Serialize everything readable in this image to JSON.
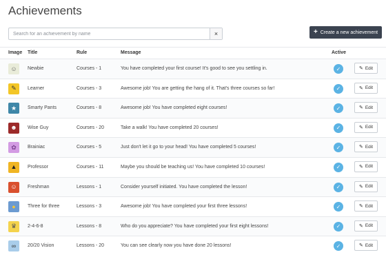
{
  "header": {
    "title": "Achievements"
  },
  "search": {
    "placeholder": "Search for an achievement by name",
    "clear": "×"
  },
  "create_button": {
    "icon": "+",
    "label": "Create a new achievement"
  },
  "columns": {
    "image": "Image",
    "title": "Title",
    "rule": "Rule",
    "message": "Message",
    "active": "Active"
  },
  "edit_label": "Edit",
  "rows": [
    {
      "title": "Newbie",
      "rule": "Courses - 1",
      "message": "You have completed your first course! It's good to see you settling in.",
      "icon": "face-icon",
      "bg": "#e9ecd9",
      "glyph": "☺",
      "color": "#666",
      "active": true
    },
    {
      "title": "Learner",
      "rule": "Courses - 3",
      "message": "Awesome job! You are getting the hang of it. That's three courses so far!",
      "icon": "pencil-badge-icon",
      "bg": "#f3c627",
      "glyph": "✎",
      "color": "#333",
      "active": true
    },
    {
      "title": "Smarty Pants",
      "rule": "Courses - 8",
      "message": "Awesome job! You have completed eight courses!",
      "icon": "smarty-pants-icon",
      "bg": "#3f87a8",
      "glyph": "★",
      "color": "#fff",
      "active": true
    },
    {
      "title": "Wise Guy",
      "rule": "Courses - 20",
      "message": "Take a walk! You have completed 20 courses!",
      "icon": "wise-guy-icon",
      "bg": "#9c2a2a",
      "glyph": "☻",
      "color": "#fff",
      "active": true
    },
    {
      "title": "Brainiac",
      "rule": "Courses - 5",
      "message": "Just don't let it go to your head! You have completed 5 courses!",
      "icon": "brain-icon",
      "bg": "#d39be3",
      "glyph": "✿",
      "color": "#7a3f8e",
      "active": true
    },
    {
      "title": "Professor",
      "rule": "Courses - 11",
      "message": "Maybe you should be teaching us! You have completed 10 courses!",
      "icon": "graduation-cap-icon",
      "bg": "#f0b523",
      "glyph": "▲",
      "color": "#222",
      "active": true
    },
    {
      "title": "Freshman",
      "rule": "Lessons - 1",
      "message": "Consider yourself initiated. You have completed the lesson!",
      "icon": "freshman-icon",
      "bg": "#d9502e",
      "glyph": "☺",
      "color": "#fff",
      "active": true
    },
    {
      "title": "Three for three",
      "rule": "Lessons - 3",
      "message": "Awesome job! You have completed your first three lessons!",
      "icon": "three-for-three-icon",
      "bg": "#6c9bd1",
      "glyph": "●",
      "color": "#f2c33a",
      "active": true
    },
    {
      "title": "2-4-6-8",
      "rule": "Lessons - 8",
      "message": "Who do you appreciate? You have completed your first eight lessons!",
      "icon": "trophy-icon",
      "bg": "#f4d34d",
      "glyph": "♛",
      "color": "#555",
      "active": true
    },
    {
      "title": "20/20 Vision",
      "rule": "Lessons - 20",
      "message": "You can see clearly now you have done 20 lessons!",
      "icon": "glasses-icon",
      "bg": "#a9cdea",
      "glyph": "∞",
      "color": "#333",
      "active": true
    }
  ]
}
